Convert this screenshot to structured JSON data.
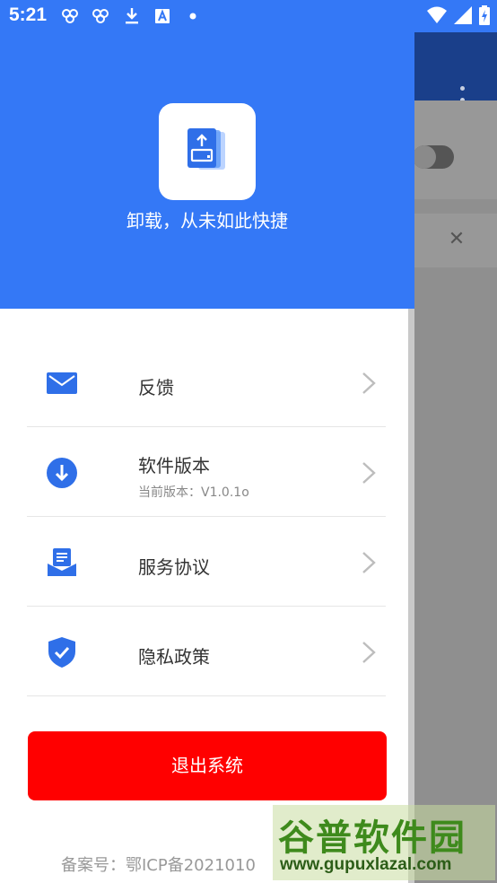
{
  "status_bar": {
    "time": "5:21"
  },
  "drawer": {
    "slogan": "卸载，从未如此快捷",
    "menu": [
      {
        "label": "反馈",
        "icon": "mail-icon"
      },
      {
        "label": "软件版本",
        "sub": "当前版本：V1.0.1o",
        "icon": "download-icon"
      },
      {
        "label": "服务协议",
        "icon": "agreement-icon"
      },
      {
        "label": "隐私政策",
        "icon": "shield-check-icon"
      }
    ],
    "logout_label": "退出系统",
    "icp": "备案号：鄂ICP备2021010"
  },
  "watermark": {
    "title": "谷普软件园",
    "url": "www.gupuxlazal.com"
  },
  "colors": {
    "accent": "#3478f6",
    "danger": "#ff0000",
    "bg_toolbar": "#1a3f8a"
  }
}
